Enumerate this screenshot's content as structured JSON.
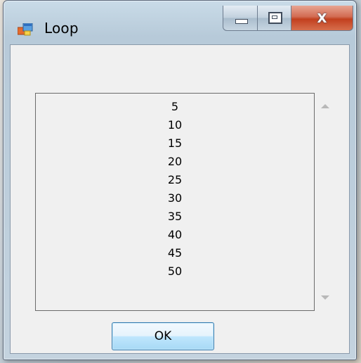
{
  "window": {
    "title": "Loop",
    "controls": {
      "minimize_icon": "minimize-icon",
      "maximize_icon": "maximize-icon",
      "close_glyph": "X"
    }
  },
  "listbox": {
    "items": [
      "5",
      "10",
      "15",
      "20",
      "25",
      "30",
      "35",
      "40",
      "45",
      "50"
    ]
  },
  "buttons": {
    "ok_label": "OK"
  },
  "colors": {
    "close_button": "#c2401e",
    "ok_button_border": "#3c7fb1",
    "client_background": "#f0f0f0"
  }
}
